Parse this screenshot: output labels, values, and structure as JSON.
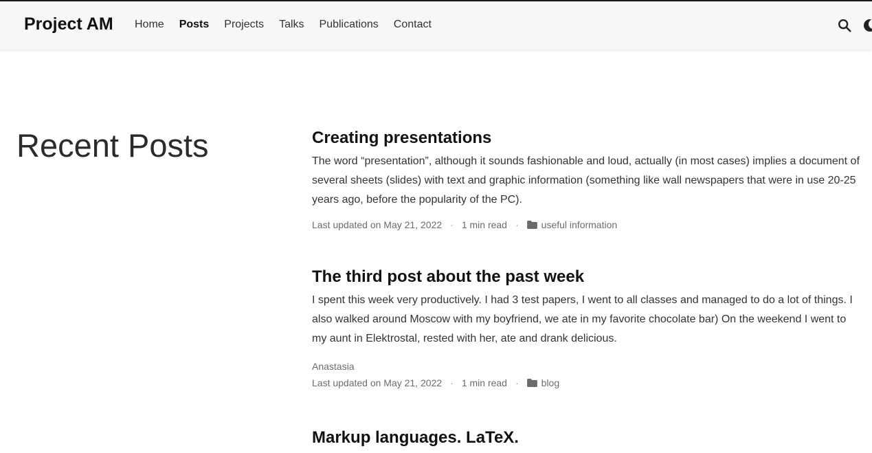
{
  "navbar": {
    "brand": "Project AM",
    "links": [
      {
        "label": "Home",
        "active": false
      },
      {
        "label": "Posts",
        "active": true
      },
      {
        "label": "Projects",
        "active": false
      },
      {
        "label": "Talks",
        "active": false
      },
      {
        "label": "Publications",
        "active": false
      },
      {
        "label": "Contact",
        "active": false
      }
    ],
    "icons": [
      "search-icon",
      "moon-icon"
    ]
  },
  "page": {
    "title": "Recent Posts"
  },
  "posts": [
    {
      "title": "Creating presentations",
      "summary": "The word “presentation”, although it sounds fashionable and loud, actually (in most cases) implies a document of several sheets (slides) with text and graphic information (something like wall newspapers that were in use 20-25 years ago, before the popularity of the PC).",
      "author": "",
      "updated": "Last updated on May 21, 2022",
      "read_time": "1 min read",
      "category": "useful information"
    },
    {
      "title": "The third post about the past week",
      "summary": "I spent this week very productively. I had 3 test papers, I went to all classes and managed to do a lot of things. I also walked around Moscow with my boyfriend, we ate in my favorite chocolate bar) On the weekend I went to my aunt in Elektrostal, rested with her, ate and drank delicious.",
      "author": "Anastasia",
      "updated": "Last updated on May 21, 2022",
      "read_time": "1 min read",
      "category": "blog"
    },
    {
      "title": "Markup languages. LaTeX.",
      "summary": "",
      "author": "",
      "updated": "",
      "read_time": "",
      "category": ""
    }
  ],
  "colors": {
    "navbar_bg": "#f7f7f7",
    "text": "#333333",
    "meta": "#6b6b6b"
  }
}
